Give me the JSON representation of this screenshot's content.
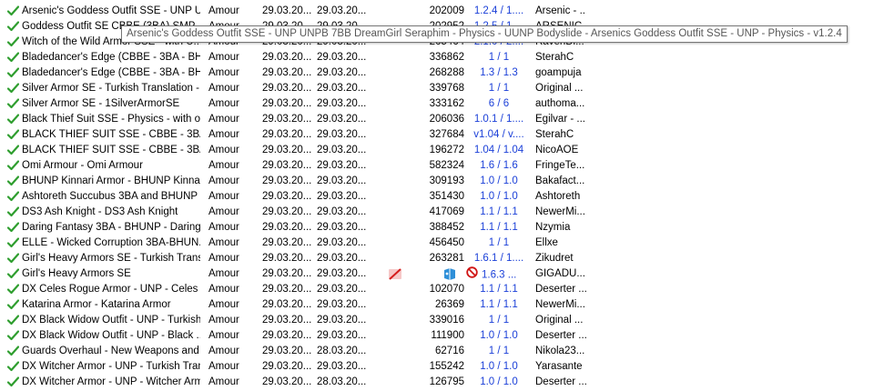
{
  "tooltip": "Arsenic's Goddess Outfit SSE - UNP UNPB 7BB DreamGirl Seraphim - Physics - UUNP Bodyslide - Arsenics Goddess Outfit SSE - UNP - Physics - v1.2.4",
  "colors": {
    "check": "#2f9e2f",
    "version": "#1a3fd8",
    "tooltip_border": "#767676"
  },
  "rows": [
    {
      "name": "Arsenic's Goddess Outfit SSE - UNP U...",
      "category": "Amour",
      "installed": "29.03.20...",
      "downloaded": "29.03.20...",
      "nexus_id": "202009",
      "version": "1.2.4 / 1....",
      "author": "Arsenic - ..."
    },
    {
      "name": "Goddess Outfit SE CBBE (3BA) SMP ...",
      "category": "Amour",
      "installed": "29.03.20...",
      "downloaded": "29.03.20...",
      "nexus_id": "202952",
      "version": "1.2.5 / 1....",
      "author": "ARSENIC"
    },
    {
      "name": "Witch of the Wild Armor SSE - with U...",
      "category": "Amour",
      "installed": "29.03.20...",
      "downloaded": "29.03.20...",
      "nexus_id": "265464",
      "version": "2.1.0 / 2....",
      "author": "RavenDi..."
    },
    {
      "name": "Bladedancer's Edge (CBBE - 3BA - BH...",
      "category": "Amour",
      "installed": "29.03.20...",
      "downloaded": "29.03.20...",
      "nexus_id": "336862",
      "version": "1 / 1",
      "author": "SterahC"
    },
    {
      "name": "Bladedancer's Edge (CBBE - 3BA - BH...",
      "category": "Amour",
      "installed": "29.03.20...",
      "downloaded": "29.03.20...",
      "nexus_id": "268288",
      "version": "1.3 / 1.3",
      "author": "goampuja"
    },
    {
      "name": "Silver Armor SE - Turkish Translation - ...",
      "category": "Amour",
      "installed": "29.03.20...",
      "downloaded": "29.03.20...",
      "nexus_id": "339768",
      "version": "1 / 1",
      "author": "Original ..."
    },
    {
      "name": "Silver Armor SE - 1SilverArmorSE",
      "category": "Amour",
      "installed": "29.03.20...",
      "downloaded": "29.03.20...",
      "nexus_id": "333162",
      "version": "6 / 6",
      "author": "authoma..."
    },
    {
      "name": "Black Thief Suit SSE - Physics - with o...",
      "category": "Amour",
      "installed": "29.03.20...",
      "downloaded": "29.03.20...",
      "nexus_id": "206036",
      "version": "1.0.1 / 1....",
      "author": "Egilvar - ..."
    },
    {
      "name": "BLACK THIEF SUIT SSE - CBBE - 3BA...",
      "category": "Amour",
      "installed": "29.03.20...",
      "downloaded": "29.03.20...",
      "nexus_id": "327684",
      "version": "v1.04 / v....",
      "author": "SterahC"
    },
    {
      "name": "BLACK THIEF SUIT SSE - CBBE - 3BA...",
      "category": "Amour",
      "installed": "29.03.20...",
      "downloaded": "29.03.20...",
      "nexus_id": "196272",
      "version": "1.04 / 1.04",
      "author": "NicoAOE"
    },
    {
      "name": "Omi Armour - Omi Armour",
      "category": "Amour",
      "installed": "29.03.20...",
      "downloaded": "29.03.20...",
      "nexus_id": "582324",
      "version": "1.6 / 1.6",
      "author": "FringeTe..."
    },
    {
      "name": "BHUNP Kinnari Armor - BHUNP Kinnari...",
      "category": "Amour",
      "installed": "29.03.20...",
      "downloaded": "29.03.20...",
      "nexus_id": "309193",
      "version": "1.0 / 1.0",
      "author": "Bakafact..."
    },
    {
      "name": "Ashtoreth Succubus 3BA and BHUNP ...",
      "category": "Amour",
      "installed": "29.03.20...",
      "downloaded": "29.03.20...",
      "nexus_id": "351430",
      "version": "1.0 / 1.0",
      "author": "Ashtoreth"
    },
    {
      "name": "DS3 Ash Knight - DS3 Ash Knight",
      "category": "Amour",
      "installed": "29.03.20...",
      "downloaded": "29.03.20...",
      "nexus_id": "417069",
      "version": "1.1 / 1.1",
      "author": "NewerMi..."
    },
    {
      "name": "Daring Fantasy 3BA - BHUNP - Daring ...",
      "category": "Amour",
      "installed": "29.03.20...",
      "downloaded": "29.03.20...",
      "nexus_id": "388452",
      "version": "1.1 / 1.1",
      "author": "Nzymia"
    },
    {
      "name": "ELLE - Wicked Corruption 3BA-BHUN...",
      "category": "Amour",
      "installed": "29.03.20...",
      "downloaded": "29.03.20...",
      "nexus_id": "456450",
      "version": "1 / 1",
      "author": "Ellxe"
    },
    {
      "name": "Girl's Heavy Armors SE - Turkish Transl...",
      "category": "Amour",
      "installed": "29.03.20...",
      "downloaded": "29.03.20...",
      "nexus_id": "263281",
      "version": "1.6.1 / 1....",
      "author": "Zikudret"
    },
    {
      "name": "Girl's Heavy Armors SE",
      "category": "Amour",
      "installed": "29.03.20...",
      "downloaded": "29.03.20...",
      "nexus_id": "",
      "version": "1.6.3 ...",
      "author": "GIGADU...",
      "special": true
    },
    {
      "name": "DX Celes Rogue Armor - UNP - Celes ...",
      "category": "Amour",
      "installed": "29.03.20...",
      "downloaded": "29.03.20...",
      "nexus_id": "102070",
      "version": "1.1 / 1.1",
      "author": "Deserter ..."
    },
    {
      "name": "Katarina Armor - Katarina Armor",
      "category": "Amour",
      "installed": "29.03.20...",
      "downloaded": "29.03.20...",
      "nexus_id": "26369",
      "version": "1.1 / 1.1",
      "author": "NewerMi..."
    },
    {
      "name": "DX Black Widow Outfit - UNP - Turkish...",
      "category": "Amour",
      "installed": "29.03.20...",
      "downloaded": "29.03.20...",
      "nexus_id": "339016",
      "version": "1 / 1",
      "author": "Original ..."
    },
    {
      "name": "DX Black Widow Outfit - UNP - Black ...",
      "category": "Amour",
      "installed": "29.03.20...",
      "downloaded": "29.03.20...",
      "nexus_id": "111900",
      "version": "1.0 / 1.0",
      "author": "Deserter ..."
    },
    {
      "name": "Guards Overhaul - New Weapons and ...",
      "category": "Amour",
      "installed": "29.03.20...",
      "downloaded": "28.03.20...",
      "nexus_id": "62716",
      "version": "1 / 1",
      "author": "Nikola23..."
    },
    {
      "name": "DX Witcher Armor - UNP - Turkish Tran...",
      "category": "Amour",
      "installed": "29.03.20...",
      "downloaded": "29.03.20...",
      "nexus_id": "155242",
      "version": "1.0 / 1.0",
      "author": "Yarasante"
    },
    {
      "name": "DX Witcher Armor - UNP - Witcher Arm...",
      "category": "Amour",
      "installed": "29.03.20...",
      "downloaded": "28.03.20...",
      "nexus_id": "126795",
      "version": "1.0 / 1.0",
      "author": "Deserter ..."
    }
  ]
}
